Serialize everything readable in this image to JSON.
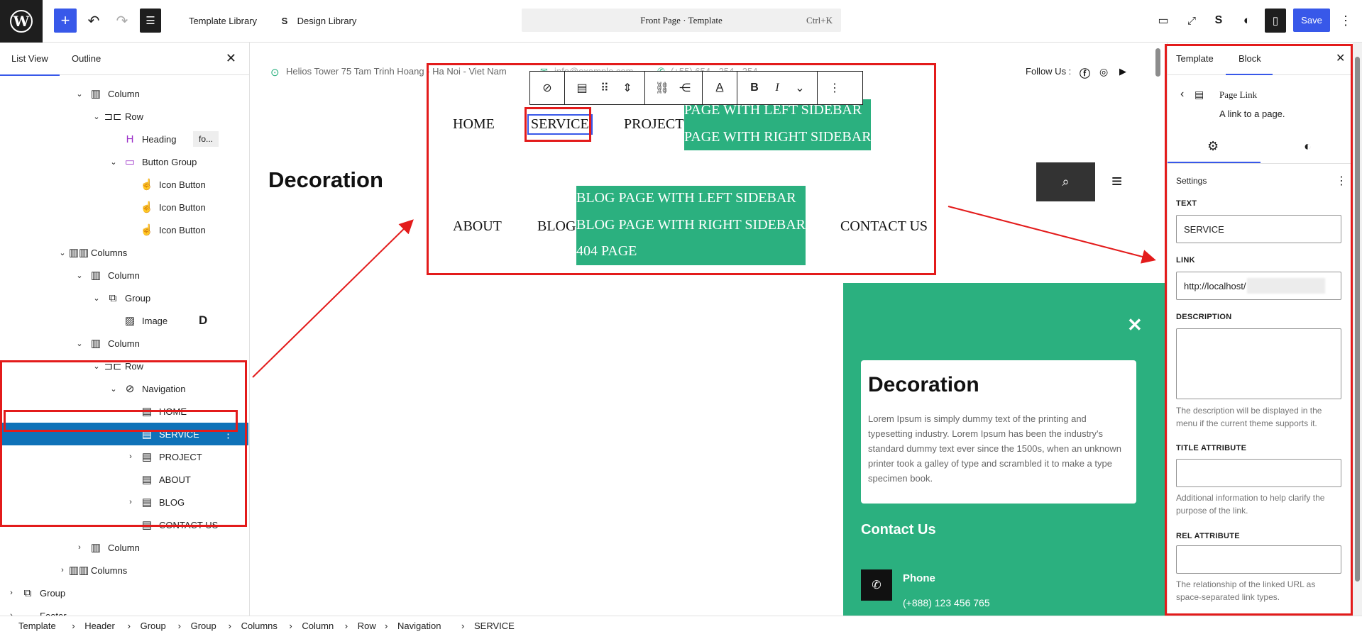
{
  "topbar": {
    "template_library": "Template Library",
    "design_library": "Design Library",
    "command_title": "Front Page · Template",
    "command_shortcut": "Ctrl+K",
    "save": "Save"
  },
  "left_panel": {
    "tabs": [
      "List View",
      "Outline"
    ],
    "tree": [
      {
        "label": "Column",
        "depth": 4,
        "chev": "v",
        "icon": "column"
      },
      {
        "label": "Row",
        "depth": 5,
        "chev": "v",
        "icon": "row"
      },
      {
        "label": "Heading",
        "depth": 6,
        "chev": "",
        "icon": "heading",
        "extra": "fo..."
      },
      {
        "label": "Button Group",
        "depth": 6,
        "chev": "v",
        "icon": "buttons"
      },
      {
        "label": "Icon Button",
        "depth": 7,
        "chev": "",
        "icon": "pointer"
      },
      {
        "label": "Icon Button",
        "depth": 7,
        "chev": "",
        "icon": "pointer"
      },
      {
        "label": "Icon Button",
        "depth": 7,
        "chev": "",
        "icon": "pointer"
      },
      {
        "label": "Columns",
        "depth": 3,
        "chev": "v",
        "icon": "columns"
      },
      {
        "label": "Column",
        "depth": 4,
        "chev": "v",
        "icon": "column"
      },
      {
        "label": "Group",
        "depth": 5,
        "chev": "v",
        "icon": "group"
      },
      {
        "label": "Image",
        "depth": 6,
        "chev": "",
        "icon": "image",
        "extra": "D"
      },
      {
        "label": "Column",
        "depth": 4,
        "chev": "v",
        "icon": "column"
      },
      {
        "label": "Row",
        "depth": 5,
        "chev": "v",
        "icon": "row"
      },
      {
        "label": "Navigation",
        "depth": 6,
        "chev": "v",
        "icon": "navigation"
      },
      {
        "label": "HOME",
        "depth": 7,
        "chev": "",
        "icon": "page"
      },
      {
        "label": "SERVICE",
        "depth": 7,
        "chev": "",
        "icon": "page",
        "selected": true
      },
      {
        "label": "PROJECT",
        "depth": 7,
        "chev": ">",
        "icon": "page"
      },
      {
        "label": "ABOUT",
        "depth": 7,
        "chev": "",
        "icon": "page"
      },
      {
        "label": "BLOG",
        "depth": 7,
        "chev": ">",
        "icon": "page"
      },
      {
        "label": "CONTACT US",
        "depth": 7,
        "chev": "",
        "icon": "page"
      },
      {
        "label": "Column",
        "depth": 4,
        "chev": ">",
        "icon": "column"
      },
      {
        "label": "Columns",
        "depth": 3,
        "chev": ">",
        "icon": "columns"
      },
      {
        "label": "Group",
        "depth": 0,
        "chev": ">",
        "icon": "group"
      },
      {
        "label": "Footer",
        "depth": 0,
        "chev": ">",
        "icon": "footer"
      }
    ]
  },
  "breadcrumb": [
    "Template",
    "Header",
    "Group",
    "Group",
    "Columns",
    "Column",
    "Row",
    "Navigation",
    "SERVICE"
  ],
  "canvas": {
    "address": "Helios Tower 75 Tam Trinh Hoang - Ha Noi - Viet Nam",
    "email": "info@example.com",
    "phone_top": "(+55) 654 - 254 - 254",
    "follow": "Follow Us :",
    "site_title": "Decoration",
    "nav": {
      "home": "HOME",
      "service": "SERVICE",
      "project": "PROJECT",
      "sub_left": "PAGE WITH LEFT SIDEBAR",
      "sub_right": "PAGE WITH RIGHT SIDEBAR",
      "about": "ABOUT",
      "blog": "BLOG",
      "blog_left": "BLOG PAGE WITH LEFT SIDEBAR",
      "blog_right": "BLOG PAGE WITH RIGHT SIDEBAR",
      "page_404": "404 PAGE",
      "contact": "CONTACT US"
    },
    "popup": {
      "card_title": "Decoration",
      "card_text": "Lorem Ipsum is simply dummy text of the printing and typesetting industry. Lorem Ipsum has been the industry's standard dummy text ever since the 1500s, when an unknown printer took a galley of type and scrambled it to make a type specimen book.",
      "contact_title": "Contact Us",
      "phone_label": "Phone",
      "phone_value": "(+888) 123 456 765"
    }
  },
  "right_panel": {
    "tabs": [
      "Template",
      "Block"
    ],
    "block_name": "Page Link",
    "block_desc": "A link to a page.",
    "settings": "Settings",
    "text_label": "TEXT",
    "text_value": "SERVICE",
    "link_label": "LINK",
    "link_value": "http://localhost/",
    "desc_label": "DESCRIPTION",
    "desc_help": "The description will be displayed in the menu if the current theme supports it.",
    "title_label": "TITLE ATTRIBUTE",
    "title_help": "Additional information to help clarify the purpose of the link.",
    "rel_label": "REL ATTRIBUTE",
    "rel_help": "The relationship of the linked URL as space-separated link types."
  },
  "colors": {
    "accent": "#3858e9",
    "selection": "#0f72b8",
    "green": "#2bb07f",
    "annotation": "#e31b1b"
  }
}
